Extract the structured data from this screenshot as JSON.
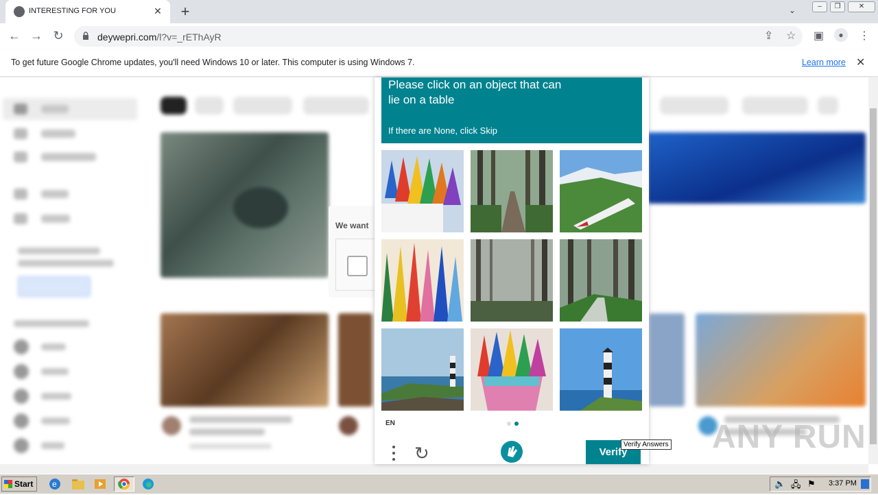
{
  "browser": {
    "tab_title": "INTERESTING FOR YOU",
    "new_tab": "+",
    "tab_close": "✕",
    "tab_search": "⌄",
    "url_host": "deywepri.com",
    "url_path": "/l?v=_rEThAyR"
  },
  "infobar": {
    "message": "To get future Google Chrome updates, you'll need Windows 10 or later. This computer is using Windows 7.",
    "learn_more": "Learn more",
    "close": "✕"
  },
  "captcha": {
    "prompt": "Please click on an object that can lie on a table",
    "sub": "If there are None, click Skip",
    "lang": "EN",
    "verify_label": "Verify",
    "tooltip": "Verify Answers",
    "page_dots": {
      "count": 2,
      "active": 2
    },
    "tiles": [
      {
        "subject": "colored pencils in cup"
      },
      {
        "subject": "forest path"
      },
      {
        "subject": "bullet train on hills"
      },
      {
        "subject": "colored pencils close-up"
      },
      {
        "subject": "misty forest"
      },
      {
        "subject": "forest stream"
      },
      {
        "subject": "lighthouse on coast"
      },
      {
        "subject": "colored pencils in cup"
      },
      {
        "subject": "lighthouse on coast"
      }
    ],
    "colors": {
      "header": "#00838f",
      "verify": "#00838f"
    }
  },
  "behind_dialog": {
    "text": "We want"
  },
  "watermark": "ANY RUN",
  "taskbar": {
    "start_label": "Start",
    "clock": "3:37 PM"
  }
}
